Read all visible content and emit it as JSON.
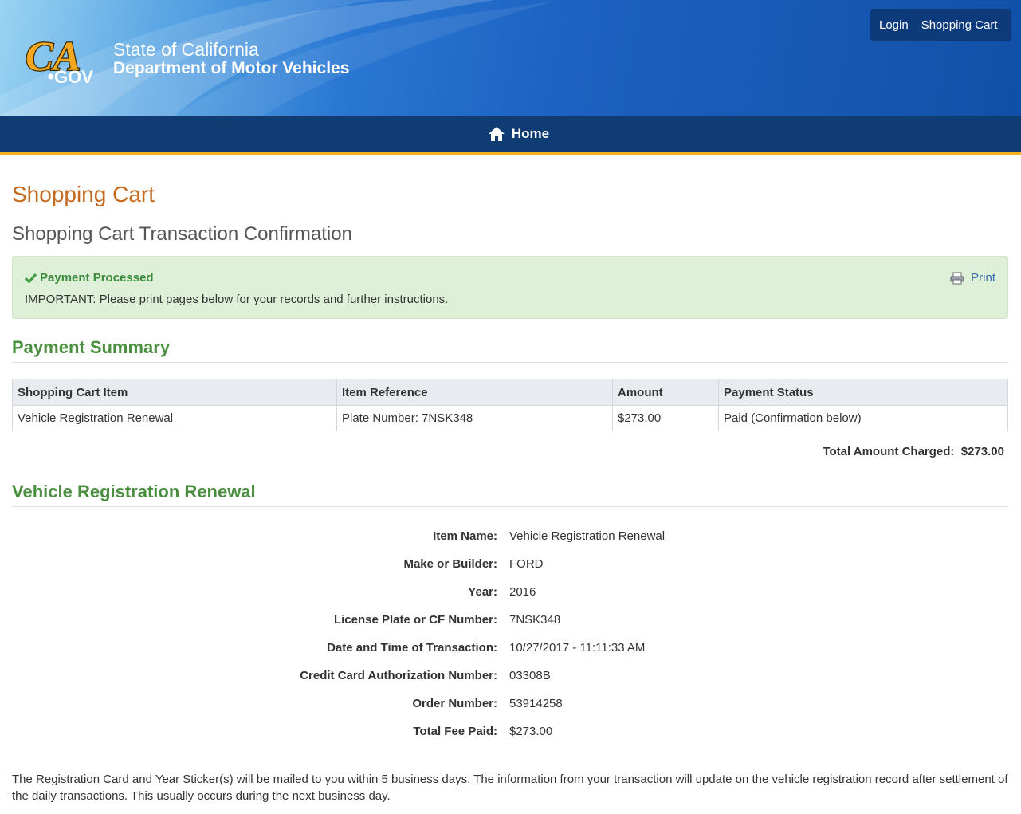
{
  "header": {
    "logo_text": "CA.GOV",
    "state": "State of California",
    "department": "Department of Motor Vehicles",
    "util_links": [
      "Login",
      "Shopping Cart"
    ]
  },
  "nav": {
    "home_label": "Home",
    "home_icon": "home-icon"
  },
  "page": {
    "title": "Shopping Cart",
    "subtitle": "Shopping Cart Transaction Confirmation"
  },
  "alert": {
    "title": "Payment Processed",
    "message": "IMPORTANT: Please print pages below for your records and further instructions.",
    "print_label": "Print"
  },
  "summary": {
    "heading": "Payment Summary",
    "columns": [
      "Shopping Cart Item",
      "Item Reference",
      "Amount",
      "Payment Status"
    ],
    "rows": [
      [
        "Vehicle Registration Renewal",
        "Plate Number: 7NSK348",
        "$273.00",
        "Paid (Confirmation below)"
      ]
    ],
    "total_label": "Total Amount Charged:",
    "total_value": "$273.00"
  },
  "renewal": {
    "heading": "Vehicle Registration Renewal",
    "fields": [
      {
        "label": "Item Name:",
        "value": "Vehicle Registration Renewal"
      },
      {
        "label": "Make or Builder:",
        "value": "FORD"
      },
      {
        "label": "Year:",
        "value": "2016"
      },
      {
        "label": "License Plate or CF Number:",
        "value": "7NSK348"
      },
      {
        "label": "Date and Time of Transaction:",
        "value": "10/27/2017 - 11:11:33 AM"
      },
      {
        "label": "Credit Card Authorization Number:",
        "value": "03308B"
      },
      {
        "label": "Order Number:",
        "value": "53914258"
      },
      {
        "label": "Total Fee Paid:",
        "value": "$273.00"
      }
    ],
    "footnote": "The Registration Card and Year Sticker(s) will be mailed to you within 5 business days. The information from your transaction will update on the vehicle registration record after settlement of the daily transactions. This usually occurs during the next business day."
  },
  "colors": {
    "header_blue": "#1c62c2",
    "nav_navy": "#0e3c73",
    "accent_gold": "#f5b31d",
    "title_orange": "#c56a1d",
    "section_green": "#4a8f3f",
    "alert_green_bg": "#dff0d8"
  }
}
